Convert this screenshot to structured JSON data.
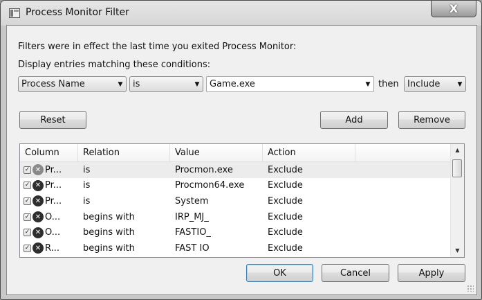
{
  "window": {
    "title": "Process Monitor Filter",
    "close_glyph": "X"
  },
  "info": {
    "line1": "Filters were in effect the last time you exited Process Monitor:",
    "line2": "Display entries matching these conditions:"
  },
  "condition": {
    "column": "Process Name",
    "relation": "is",
    "value": "Game.exe",
    "then_label": "then",
    "action": "Include"
  },
  "buttons": {
    "reset": "Reset",
    "add": "Add",
    "remove": "Remove",
    "ok": "OK",
    "cancel": "Cancel",
    "apply": "Apply"
  },
  "list": {
    "headers": [
      "Column",
      "Relation",
      "Value",
      "Action"
    ],
    "rows": [
      {
        "column": "Pr...",
        "relation": "is",
        "value": "Procmon.exe",
        "action": "Exclude",
        "checked": true
      },
      {
        "column": "Pr...",
        "relation": "is",
        "value": "Procmon64.exe",
        "action": "Exclude",
        "checked": true
      },
      {
        "column": "Pr...",
        "relation": "is",
        "value": "System",
        "action": "Exclude",
        "checked": true
      },
      {
        "column": "O...",
        "relation": "begins with",
        "value": "IRP_MJ_",
        "action": "Exclude",
        "checked": true
      },
      {
        "column": "O...",
        "relation": "begins with",
        "value": "FASTIO_",
        "action": "Exclude",
        "checked": true
      },
      {
        "column": "R...",
        "relation": "begins with",
        "value": "FAST IO",
        "action": "Exclude",
        "checked": true
      }
    ]
  },
  "icons": {
    "checkbox_mark": "✓",
    "exclude_glyph": "✕",
    "dropdown": "▼",
    "scroll_up": "▲",
    "scroll_down": "▼"
  }
}
